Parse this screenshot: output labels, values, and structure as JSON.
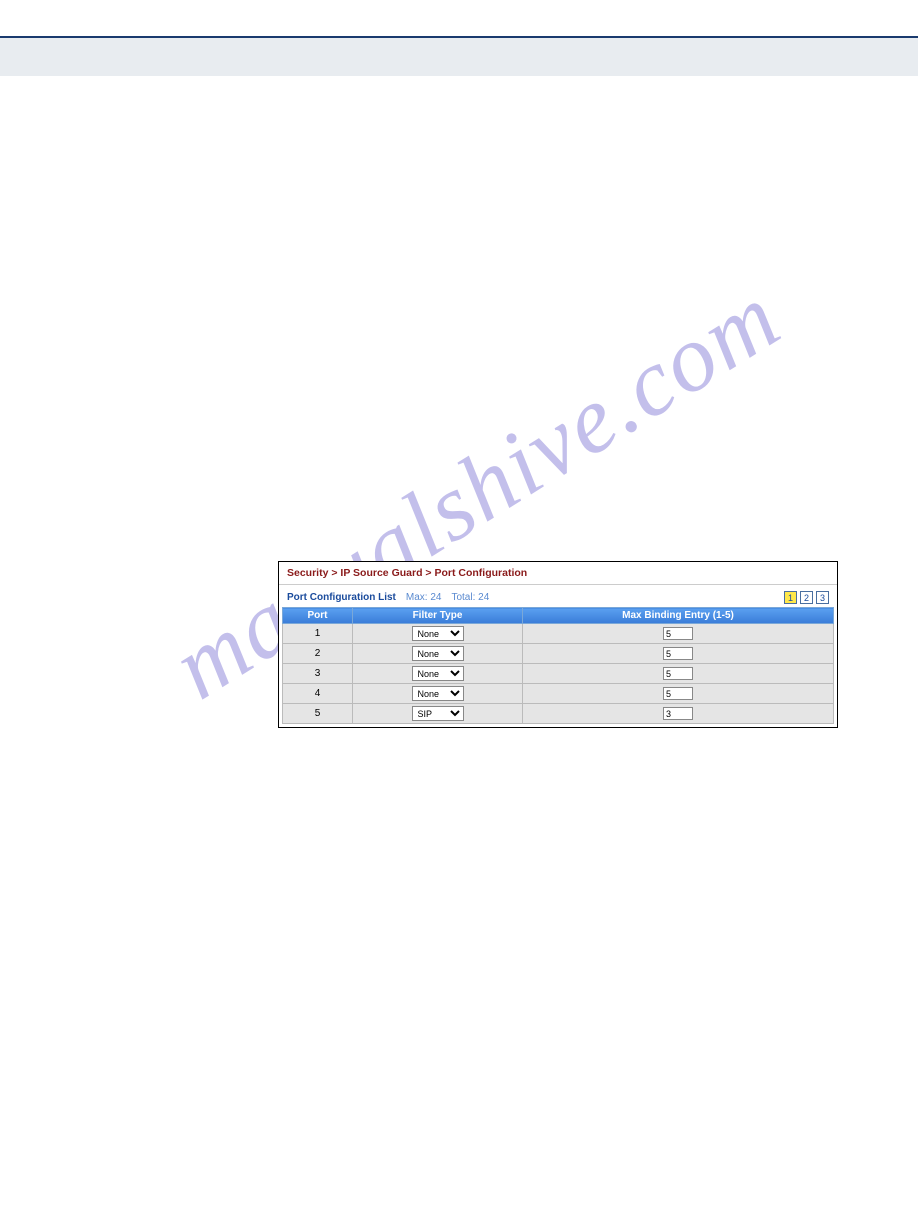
{
  "breadcrumb": "Security > IP Source Guard > Port Configuration",
  "list": {
    "title": "Port Configuration List",
    "max_label": "Max: 24",
    "total_label": "Total: 24"
  },
  "pager": {
    "pages": [
      "1",
      "2",
      "3"
    ],
    "active": 0
  },
  "table": {
    "headers": [
      "Port",
      "Filter Type",
      "Max Binding Entry (1-5)"
    ],
    "rows": [
      {
        "port": "1",
        "filter": "None",
        "binding": "5"
      },
      {
        "port": "2",
        "filter": "None",
        "binding": "5"
      },
      {
        "port": "3",
        "filter": "None",
        "binding": "5"
      },
      {
        "port": "4",
        "filter": "None",
        "binding": "5"
      },
      {
        "port": "5",
        "filter": "SIP",
        "binding": "3"
      }
    ],
    "filter_options": [
      "None",
      "SIP"
    ]
  },
  "watermark": "manualshive.com"
}
